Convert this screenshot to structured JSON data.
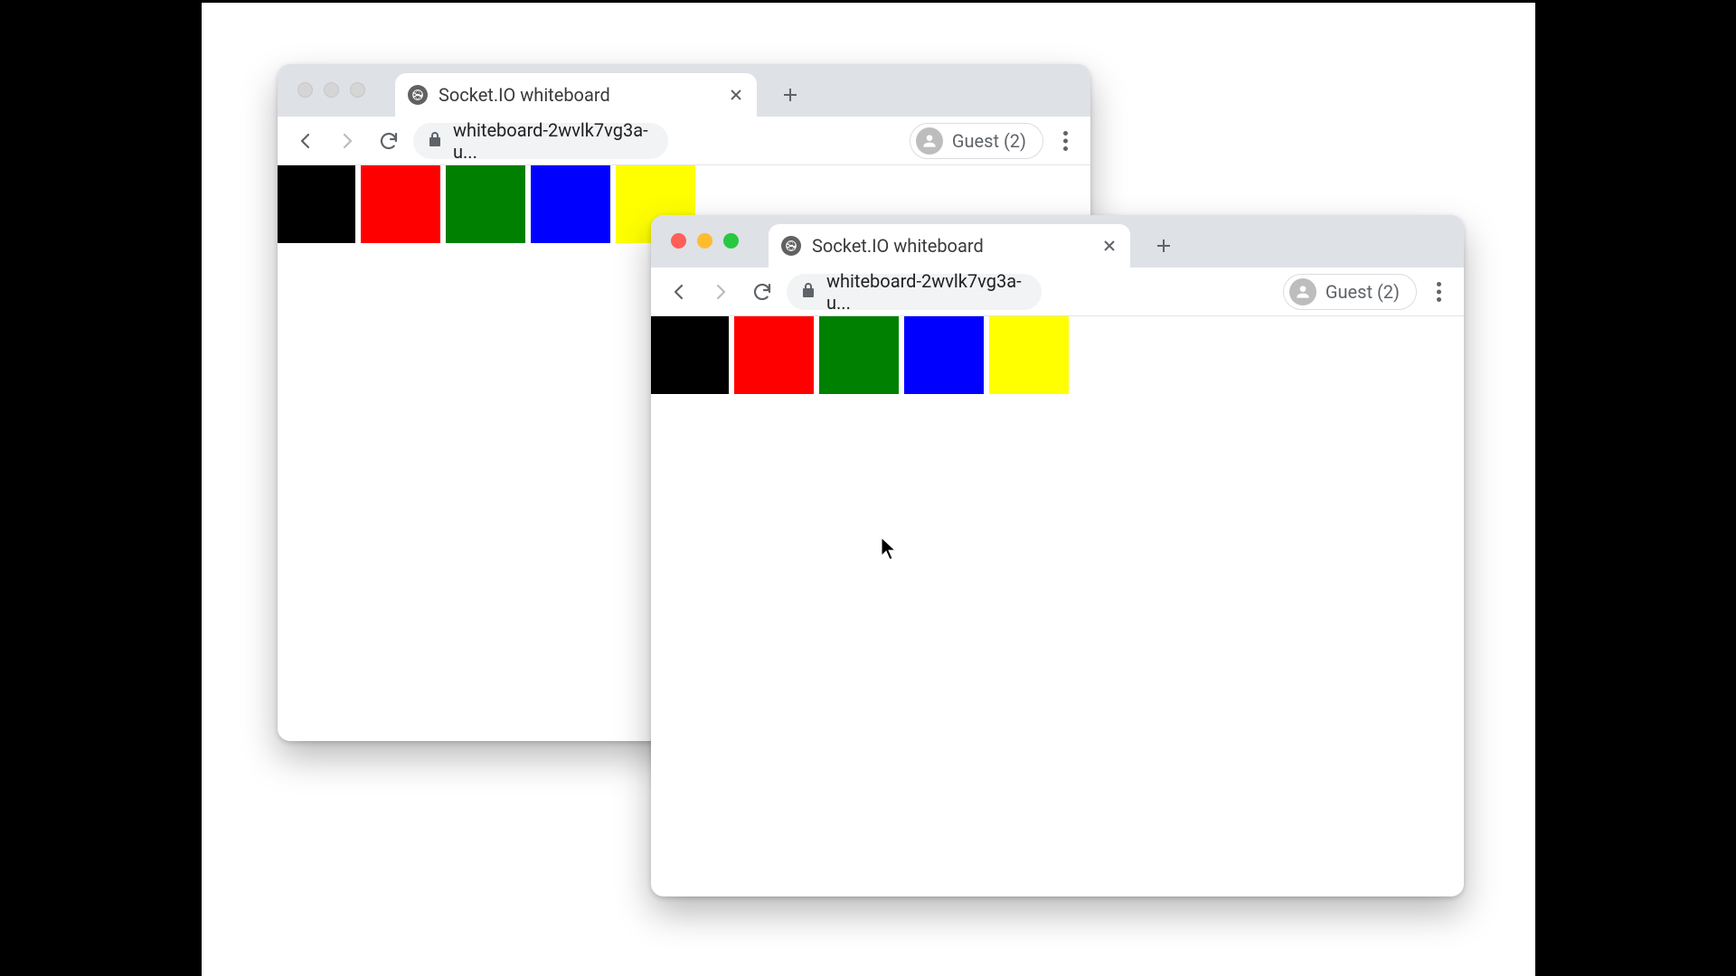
{
  "windows": {
    "back": {
      "active": false,
      "tab_title": "Socket.IO whiteboard",
      "url_display": "whiteboard-2wvlk7vg3a-u...",
      "profile_label": "Guest (2)",
      "palette": [
        {
          "name": "black",
          "hex": "#000000"
        },
        {
          "name": "red",
          "hex": "#ff0000"
        },
        {
          "name": "green",
          "hex": "#008000"
        },
        {
          "name": "blue",
          "hex": "#0000ff"
        },
        {
          "name": "yellow",
          "hex": "#ffff00"
        }
      ]
    },
    "front": {
      "active": true,
      "tab_title": "Socket.IO whiteboard",
      "url_display": "whiteboard-2wvlk7vg3a-u...",
      "profile_label": "Guest (2)",
      "palette": [
        {
          "name": "black",
          "hex": "#000000"
        },
        {
          "name": "red",
          "hex": "#ff0000"
        },
        {
          "name": "green",
          "hex": "#008000"
        },
        {
          "name": "blue",
          "hex": "#0000ff"
        },
        {
          "name": "yellow",
          "hex": "#ffff00"
        }
      ]
    }
  },
  "traffic_light_colors": {
    "red": "#ff5f57",
    "yellow": "#febc2e",
    "green": "#28c840",
    "inactive": "#d5d5d5"
  }
}
